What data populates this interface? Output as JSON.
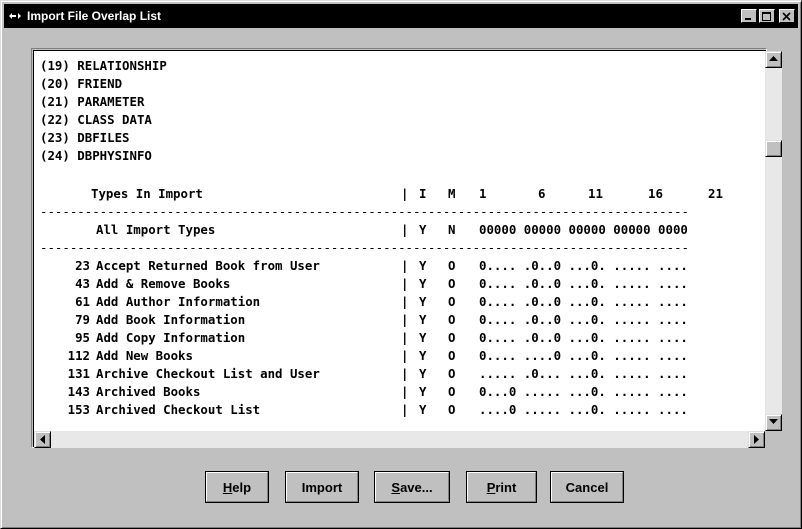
{
  "window": {
    "title": "Import File Overlap List"
  },
  "listing": {
    "lines": [
      "(19) RELATIONSHIP",
      "(20) FRIEND",
      "(21) PARAMETER",
      "(22) CLASS DATA",
      "(23) DBFILES",
      "(24) DBPHYSINFO",
      "",
      "    Types In Import               | I  M  1      6     11    16    21    |",
      "----------------------------------|--------------------------------------|",
      "     All Import Types             | Y  N  00000 00000 00000 00000 0000  |",
      "----------------------------------|--------------------------------------|",
      "   23 Accept Returned Book from User | Y  O  0.... .0..0 ...0. ..... .... |",
      "   43 Add & Remove Books           | Y  O  0.... .0..0 ...0. ..... .... |",
      "   61 Add Author Information       | Y  O  0.... .0..0 ...0. ..... .... |",
      "   79 Add Book Information         | Y  O  0.... .0..0 ...0. ..... .... |",
      "   95 Add Copy Information         | Y  O  0.... .0..0 ...0. ..... .... |",
      "  112 Add New Books                | Y  O  0.... ....0 ...0. ..... .... |",
      "  131 Archive Checkout List and User | Y  O  ..... .0... ...0. ..... .... |",
      "  143 Archived Books               | Y  O  0...0 ..... ...0. ..... .... |",
      "  153 Archived Checkout List       | Y  O  ....0 ..... ...0. ..... .... |"
    ],
    "header": {
      "types": "Types In Import",
      "i": "I",
      "m": "M",
      "c1": "1",
      "c6": "6",
      "c11": "11",
      "c16": "16",
      "c21": "21"
    },
    "all_row": {
      "label": "All Import Types",
      "i": "Y",
      "m": "N",
      "vals": "00000 00000 00000 00000 0000"
    },
    "rows": [
      {
        "num": "23",
        "name": "Accept Returned Book from User",
        "i": "Y",
        "m": "O",
        "vals": "0.... .0..0 ...0. ..... ...."
      },
      {
        "num": "43",
        "name": "Add & Remove Books",
        "i": "Y",
        "m": "O",
        "vals": "0.... .0..0 ...0. ..... ...."
      },
      {
        "num": "61",
        "name": "Add Author Information",
        "i": "Y",
        "m": "O",
        "vals": "0.... .0..0 ...0. ..... ...."
      },
      {
        "num": "79",
        "name": "Add Book Information",
        "i": "Y",
        "m": "O",
        "vals": "0.... .0..0 ...0. ..... ...."
      },
      {
        "num": "95",
        "name": "Add Copy Information",
        "i": "Y",
        "m": "O",
        "vals": "0.... .0..0 ...0. ..... ...."
      },
      {
        "num": "112",
        "name": "Add New Books",
        "i": "Y",
        "m": "O",
        "vals": "0.... ....0 ...0. ..... ...."
      },
      {
        "num": "131",
        "name": "Archive Checkout List and User",
        "i": "Y",
        "m": "O",
        "vals": "..... .0... ...0. ..... ...."
      },
      {
        "num": "143",
        "name": "Archived Books",
        "i": "Y",
        "m": "O",
        "vals": "0...0 ..... ...0. ..... ...."
      },
      {
        "num": "153",
        "name": "Archived Checkout List",
        "i": "Y",
        "m": "O",
        "vals": "....0 ..... ...0. ..... ...."
      }
    ],
    "types": [
      "(19) RELATIONSHIP",
      "(20) FRIEND",
      "(21) PARAMETER",
      "(22) CLASS DATA",
      "(23) DBFILES",
      "(24) DBPHYSINFO"
    ]
  },
  "buttons": {
    "help": {
      "pre": "",
      "u": "H",
      "post": "elp"
    },
    "import": {
      "pre": "Import",
      "u": "",
      "post": ""
    },
    "save": {
      "pre": "",
      "u": "S",
      "post": "ave..."
    },
    "print": {
      "pre": "",
      "u": "P",
      "post": "rint"
    },
    "cancel": {
      "pre": "Cancel",
      "u": "",
      "post": ""
    }
  },
  "colors": {
    "titlebar": "#000000",
    "window": "#c0c0c0",
    "content": "#ffffff"
  }
}
